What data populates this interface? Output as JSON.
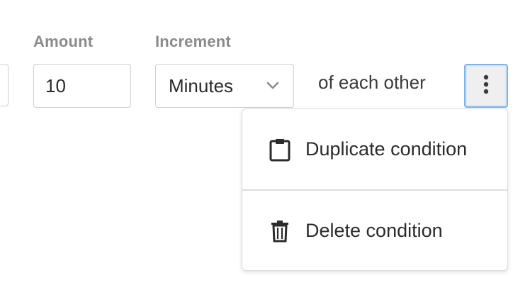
{
  "fields": {
    "amount": {
      "label": "Amount",
      "value": "10"
    },
    "increment": {
      "label": "Increment",
      "selected": "Minutes"
    },
    "suffix_text": "of each other"
  },
  "more_button": {
    "icon": "vertical-ellipsis-icon"
  },
  "menu": {
    "items": [
      {
        "label": "Duplicate condition",
        "icon": "clipboard-icon"
      },
      {
        "label": "Delete condition",
        "icon": "trash-icon"
      }
    ]
  },
  "colors": {
    "focus_border": "#7fb3e6",
    "label_gray": "#8a8a8a",
    "text": "#2b2b2b",
    "border": "#cfcfcf"
  }
}
